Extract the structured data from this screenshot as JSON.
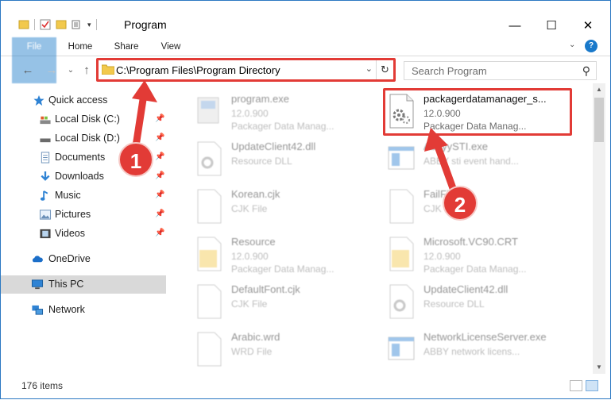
{
  "window": {
    "title": "Program",
    "minimize_glyph": "—",
    "maximize_glyph": "☐",
    "close_glyph": "✕"
  },
  "ribbon": {
    "tabs": [
      "File",
      "Home",
      "Share",
      "View"
    ],
    "help_glyph": "?",
    "expand_glyph": "⌄"
  },
  "address_bar": {
    "path": "C:\\Program Files\\Program Directory",
    "dropdown_glyph": "⌄",
    "refresh_glyph": "↻"
  },
  "search": {
    "placeholder": "Search Program",
    "icon": "search-icon"
  },
  "nav_buttons": {
    "back": "←",
    "forward": "→",
    "recent": "⌄",
    "up": "↑"
  },
  "navigation_pane": {
    "items": [
      {
        "label": "Quick access",
        "icon": "star-icon",
        "pinned": false
      },
      {
        "label": "Local Disk (C:)",
        "icon": "drive-icon",
        "pinned": true
      },
      {
        "label": "Local Disk (D:)",
        "icon": "drive-icon",
        "pinned": true
      },
      {
        "label": "Documents",
        "icon": "documents-icon",
        "pinned": true
      },
      {
        "label": "Downloads",
        "icon": "download-icon",
        "pinned": true
      },
      {
        "label": "Music",
        "icon": "music-icon",
        "pinned": true
      },
      {
        "label": "Pictures",
        "icon": "pictures-icon",
        "pinned": true
      },
      {
        "label": "Videos",
        "icon": "videos-icon",
        "pinned": true
      },
      {
        "label": "OneDrive",
        "icon": "onedrive-icon",
        "pinned": false
      },
      {
        "label": "This PC",
        "icon": "pc-icon",
        "pinned": false,
        "selected": true
      },
      {
        "label": "Network",
        "icon": "network-icon",
        "pinned": false
      }
    ],
    "pin_glyph": "📌"
  },
  "files": [
    {
      "name": "program.exe",
      "line1": "12.0.900",
      "line2": "Packager Data Manag...",
      "icon": "exe-icon"
    },
    {
      "name": "packagerdatamanager_s...",
      "line1": "12.0.900",
      "line2": "Packager Data Manag...",
      "icon": "dll-gear-icon",
      "highlighted": true
    },
    {
      "name": "UpdateClient42.dll",
      "line1": "Resource DLL",
      "line2": "",
      "icon": "dll-gear-icon"
    },
    {
      "name": "AbbyySTI.exe",
      "line1": "ABBY sti event hand...",
      "line2": "",
      "icon": "exe-window-icon"
    },
    {
      "name": "Korean.cjk",
      "line1": "CJK File",
      "line2": "",
      "icon": "blank-file-icon"
    },
    {
      "name": "FailFile.cjk",
      "line1": "CJK File",
      "line2": "",
      "icon": "blank-file-icon"
    },
    {
      "name": "Resource",
      "line1": "12.0.900",
      "line2": "Packager Data Manag...",
      "icon": "folder-file-icon"
    },
    {
      "name": "Microsoft.VC90.CRT",
      "line1": "12.0.900",
      "line2": "Packager Data Manag...",
      "icon": "folder-file-icon"
    },
    {
      "name": "DefaultFont.cjk",
      "line1": "CJK File",
      "line2": "",
      "icon": "blank-file-icon"
    },
    {
      "name": "UpdateClient42.dll",
      "line1": "Resource DLL",
      "line2": "",
      "icon": "dll-gear-icon"
    },
    {
      "name": "Arabic.wrd",
      "line1": "WRD File",
      "line2": "",
      "icon": "blank-file-icon"
    },
    {
      "name": "NetworkLicenseServer.exe",
      "line1": "ABBY network licens...",
      "line2": "",
      "icon": "exe-window-icon"
    }
  ],
  "status_bar": {
    "item_count": "176 items"
  },
  "annotations": {
    "step1": "1",
    "step2": "2"
  },
  "colors": {
    "accent": "#1979ca",
    "highlight": "#e23b36",
    "selected_nav": "#d9d9d9"
  }
}
